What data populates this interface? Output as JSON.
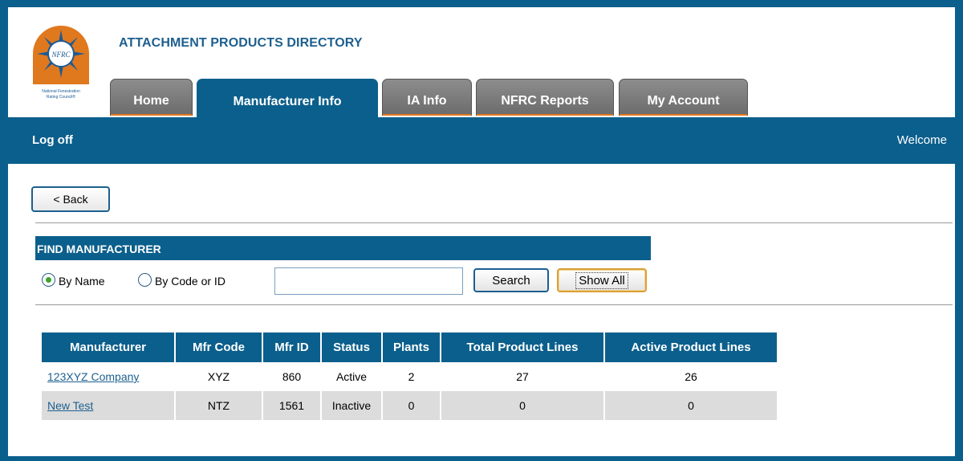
{
  "header": {
    "site_title": "ATTACHMENT PRODUCTS DIRECTORY",
    "logo_text": "NFRC",
    "logo_caption": "National Fenestration Rating Council®"
  },
  "tabs": [
    {
      "label": "Home",
      "active": false
    },
    {
      "label": "Manufacturer Info",
      "active": true
    },
    {
      "label": "IA Info",
      "active": false
    },
    {
      "label": "NFRC Reports",
      "active": false
    },
    {
      "label": "My Account",
      "active": false
    }
  ],
  "nav_bar": {
    "logoff": "Log off",
    "welcome": "Welcome"
  },
  "back_button": "< Back",
  "find": {
    "title": "FIND MANUFACTURER",
    "radio_by_name": "By Name",
    "radio_by_code": "By Code or ID",
    "selected": "By Name",
    "search_value": "",
    "search_button": "Search",
    "show_all_button": "Show All"
  },
  "table": {
    "headers": [
      "Manufacturer",
      "Mfr Code",
      "Mfr ID",
      "Status",
      "Plants",
      "Total Product Lines",
      "Active Product Lines"
    ],
    "rows": [
      [
        "123XYZ Company",
        "XYZ",
        "860",
        "Active",
        "2",
        "27",
        "26"
      ],
      [
        "New Test",
        "NTZ",
        "1561",
        "Inactive",
        "0",
        "0",
        "0"
      ]
    ]
  },
  "colors": {
    "primary_blue": "#0b5f8c",
    "tab_gray": "#7a7a7a",
    "tab_accent": "#e07a1f",
    "row_alt": "#dcdcdc",
    "link": "#1d5f8f"
  }
}
